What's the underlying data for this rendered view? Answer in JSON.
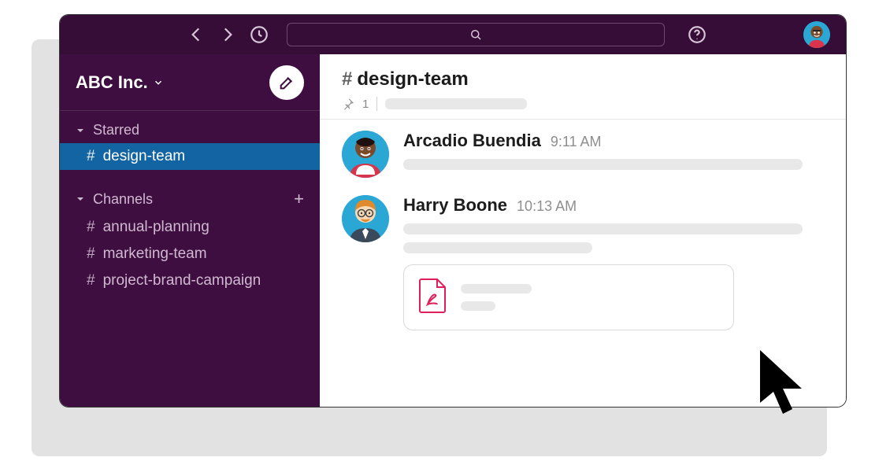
{
  "workspace": {
    "name": "ABC Inc."
  },
  "sidebar": {
    "sections": [
      {
        "label": "Starred",
        "items": [
          {
            "label": "design-team",
            "active": true
          }
        ]
      },
      {
        "label": "Channels",
        "add": true,
        "items": [
          {
            "label": "annual-planning"
          },
          {
            "label": "marketing-team"
          },
          {
            "label": "project-brand-campaign"
          }
        ]
      }
    ]
  },
  "channel": {
    "name": "design-team",
    "hash": "#",
    "pinned_count": "1"
  },
  "messages": [
    {
      "author": "Arcadio Buendia",
      "time": "9:11 AM"
    },
    {
      "author": "Harry Boone",
      "time": "10:13 AM",
      "attachment": {
        "kind": "pdf"
      }
    }
  ],
  "icons": {
    "compose": "compose",
    "history": "history",
    "back": "back",
    "forward": "forward",
    "search": "search",
    "help": "help",
    "pin": "pin",
    "caret": "caret"
  }
}
